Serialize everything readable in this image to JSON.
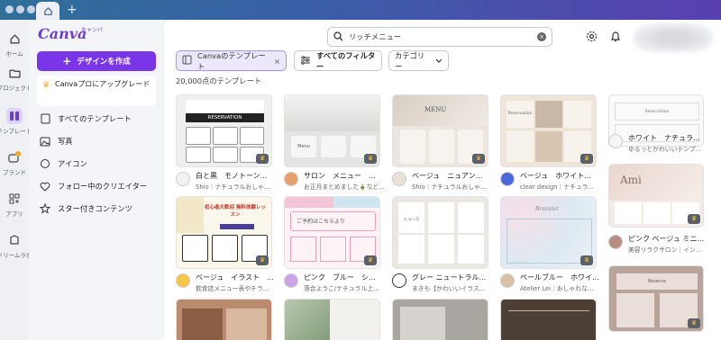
{
  "titlebar": {
    "new_tab": "+"
  },
  "rail": {
    "items": [
      {
        "label": "ホーム",
        "icon": "home-icon"
      },
      {
        "label": "プロジェクト",
        "icon": "folder-icon"
      },
      {
        "label": "テンプレート",
        "icon": "template-icon"
      },
      {
        "label": "ブランド",
        "icon": "brand-icon"
      },
      {
        "label": "アプリ",
        "icon": "apps-icon"
      },
      {
        "label": "ドリームラボ",
        "icon": "dreamlab-icon"
      }
    ]
  },
  "panel": {
    "logo": "Canva",
    "logo_kana": "キャンバ",
    "create_label": "デザインを作成",
    "upgrade_label": "Canvaプロにアップグレード",
    "nav": [
      {
        "label": "すべてのテンプレート",
        "icon": "doc-icon"
      },
      {
        "label": "写真",
        "icon": "photo-icon"
      },
      {
        "label": "アイコン",
        "icon": "shapes-icon"
      },
      {
        "label": "フォロー中のクリエイター",
        "icon": "heart-icon"
      },
      {
        "label": "スター付きコンテンツ",
        "icon": "star-icon"
      }
    ]
  },
  "search": {
    "value": "リッチメニュー"
  },
  "filters": {
    "canva_chip": "Canvaのテンプレート",
    "all_filters": "すべてのフィルター",
    "category": "カテゴリー"
  },
  "results": {
    "count": "20,000点のテンプレート"
  },
  "cards": [
    {
      "title": "白と黒　モノトーン...",
      "sub": "Shio｜ナチュラルおしゃ...",
      "card_text": "RESERVATION"
    },
    {
      "title": "サロン　メニュー　...",
      "sub": "お正月まとめました🎍など...",
      "card_text": "Menu"
    },
    {
      "title": "ベージュ　ニュアン...",
      "sub": "Shio｜ナチュラルおしゃ...",
      "card_text": "MENU"
    },
    {
      "title": "ベージュ　ホワイト...",
      "sub": "clear design｜ナチュラ...",
      "card_text": "Reservation"
    },
    {
      "title": "ホワイト　ナチュラ...",
      "sub": "ゆるっとかわいいテンプ...",
      "card_text": "Reservation"
    },
    {
      "title": "ベージュ　イラスト　...",
      "sub": "飲食店メニュー表やチラ...",
      "card_text": "初心者大歓迎 無料体験レッスン"
    },
    {
      "title": "ピンク　ブルー　シ...",
      "sub": "落合ようこ/ナチュラル上...",
      "card_text": "ご予約はこちらより"
    },
    {
      "title": "グレー ニュートラル...",
      "sub": "まきも【かわいいイラス...",
      "card_text": "ニュース"
    },
    {
      "title": "ペールブルー　ホワイ...",
      "sub": "Atelier Lei｜おしゃれな...",
      "card_text": "Bracelet"
    },
    {
      "title": "ピンク ベージュ ミニ...",
      "sub": "美容リラクサロン｜イン...",
      "card_text": "Ami"
    },
    {
      "card_text": "Reserve"
    }
  ],
  "colors": {
    "accent": "#7a35e8",
    "canva_chip_bg": "#ece8fb"
  }
}
